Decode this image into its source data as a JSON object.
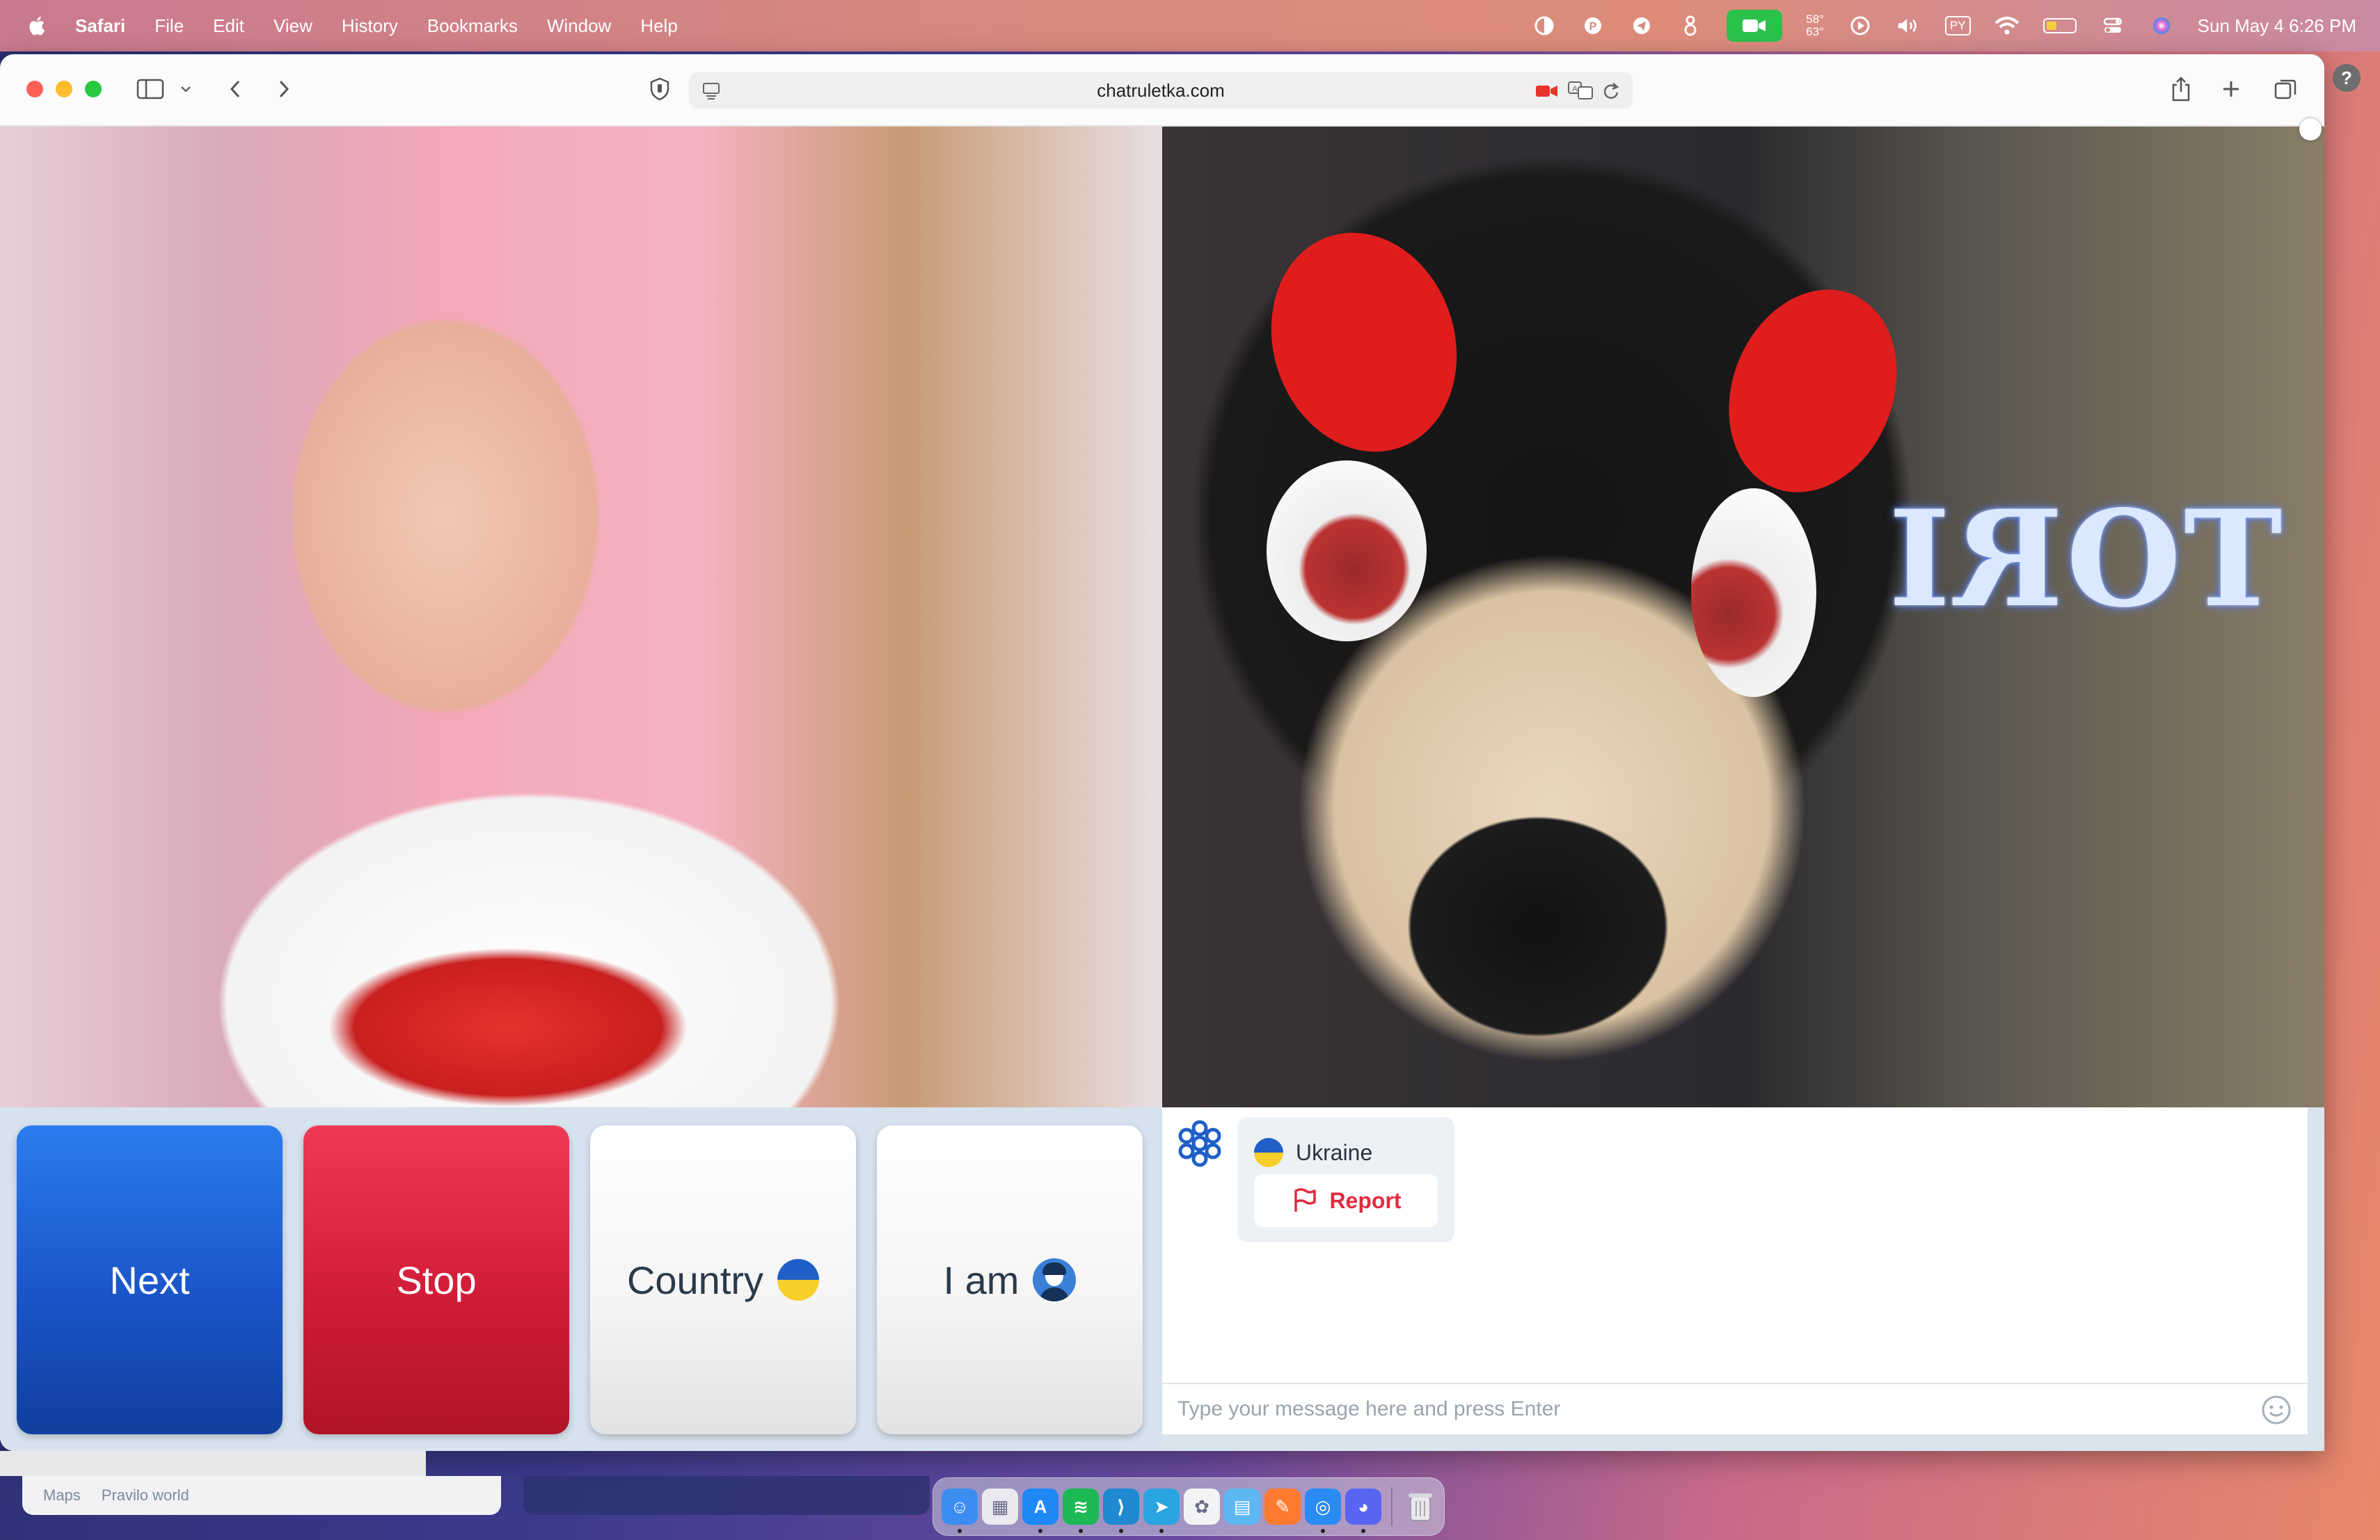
{
  "menubar": {
    "app_name": "Safari",
    "items": [
      "File",
      "Edit",
      "View",
      "History",
      "Bookmarks",
      "Window",
      "Help"
    ],
    "temp_top": "58°",
    "temp_bottom": "63°",
    "keyboard_layout": "PY",
    "clock": "Sun May 4  6:26 PM"
  },
  "browser": {
    "url": "chatruletka.com"
  },
  "controls": {
    "next_label": "Next",
    "stop_label": "Stop",
    "country_label": "Country",
    "iam_label": "I am"
  },
  "chat": {
    "partner_country": "Ukraine",
    "report_label": "Report",
    "input_placeholder": "Type your message here and press Enter"
  },
  "background_window": {
    "app_label": "Maps",
    "tab_label": "Pravilo world"
  },
  "video_right": {
    "sign_text": "TORI"
  },
  "dock": {
    "apps": [
      {
        "name": "finder",
        "color": "#3b8ef0",
        "glyph": "☺"
      },
      {
        "name": "launchpad",
        "color": "#e9e9ef",
        "glyph": "▦"
      },
      {
        "name": "app-store",
        "color": "#1e88f5",
        "glyph": "A"
      },
      {
        "name": "spotify",
        "color": "#1db954",
        "glyph": "≋"
      },
      {
        "name": "vscode",
        "color": "#1f8ad2",
        "glyph": "⟩"
      },
      {
        "name": "telegram",
        "color": "#2aa4e0",
        "glyph": "➤"
      },
      {
        "name": "photos-app",
        "color": "#f3f3f6",
        "glyph": "✿"
      },
      {
        "name": "finder-folder",
        "color": "#5cb7f2",
        "glyph": "▤"
      },
      {
        "name": "pencil-app",
        "color": "#ff7a2f",
        "glyph": "✎"
      },
      {
        "name": "safari",
        "color": "#2a8cf3",
        "glyph": "◎"
      },
      {
        "name": "discord",
        "color": "#5865f2",
        "glyph": "◕"
      }
    ]
  },
  "colors": {
    "next_blue": "#1a55c8",
    "stop_red": "#d11c38",
    "report_red": "#e02b3f",
    "ukraine_blue": "#1f5fc7",
    "ukraine_yellow": "#f7cf2b"
  }
}
